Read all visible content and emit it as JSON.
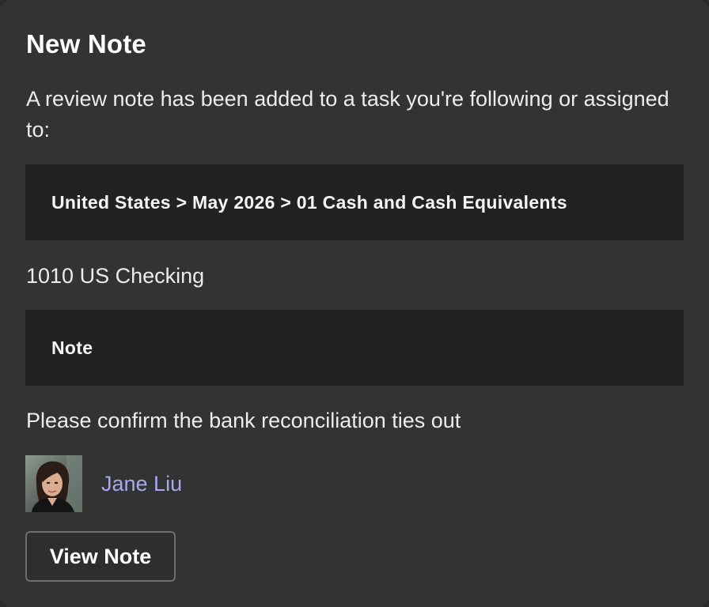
{
  "card": {
    "title": "New Note",
    "intro": "A review note has been added to a task you're following or assigned to:",
    "path": "United States > May 2026 > 01 Cash and Cash Equivalents",
    "account": "1010 US Checking",
    "note_heading": "Note",
    "note_text": "Please confirm the bank reconciliation ties out",
    "author": {
      "name": "Jane Liu",
      "avatar_icon": "user-photo"
    },
    "view_button_label": "View Note"
  },
  "colors": {
    "card_background": "#333333",
    "band_background": "#222222",
    "author_link": "#a9a9f0",
    "button_border": "#6e6e6e"
  }
}
